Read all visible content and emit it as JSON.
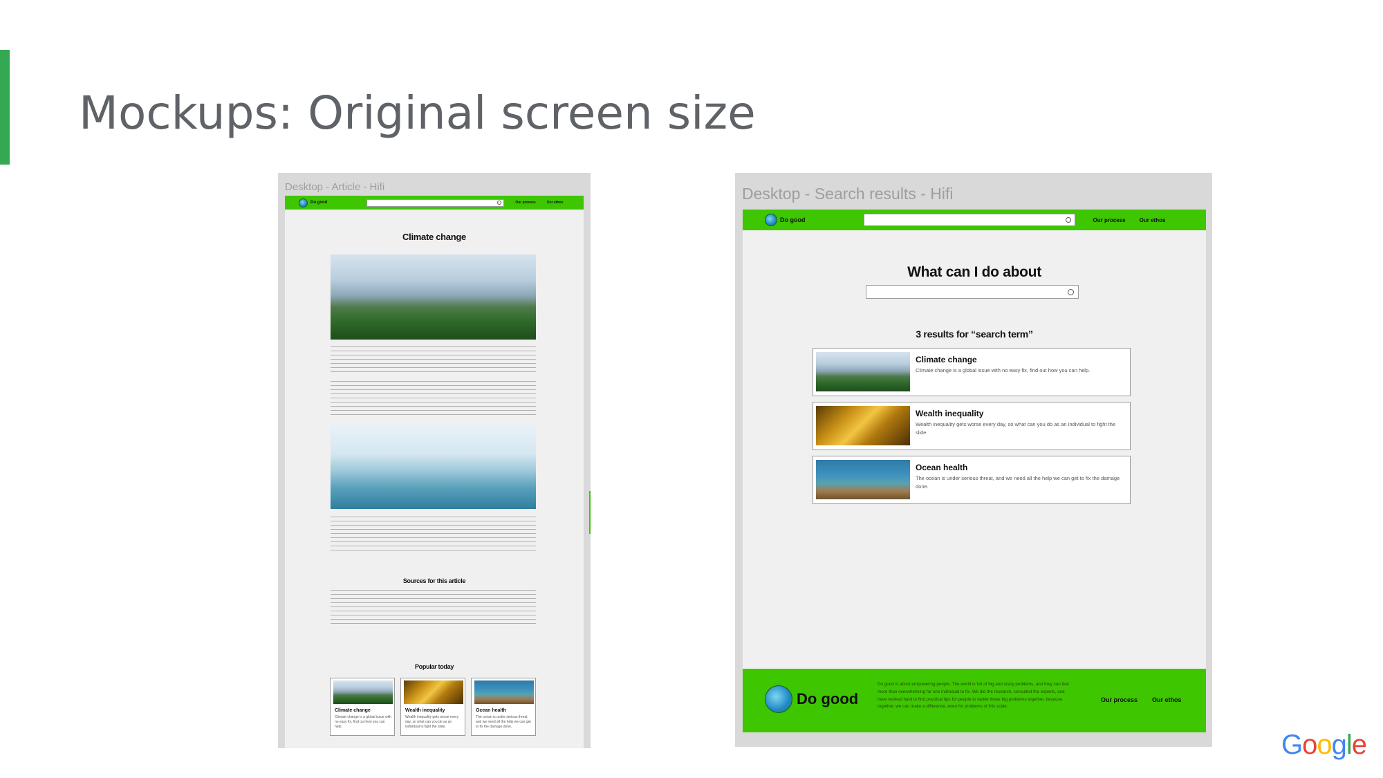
{
  "slide": {
    "title": "Mockups: Original screen size",
    "accent_color": "#34a853",
    "google_logo": [
      "G",
      "o",
      "o",
      "g",
      "l",
      "e"
    ],
    "google_colors": [
      "#4285f4",
      "#ea4335",
      "#fbbc05",
      "#4285f4",
      "#34a853",
      "#ea4335"
    ]
  },
  "brand": {
    "name": "Do good",
    "green": "#3ec600",
    "nav_links": [
      "Our process",
      "Our ethos"
    ]
  },
  "article_mockup": {
    "frame_label": "Desktop - Article - Hifi",
    "title": "Climate change",
    "sources_heading": "Sources for this article",
    "popular_heading": "Popular today",
    "popular": [
      {
        "title": "Climate change",
        "desc": "Climate change is a global issue with no easy fix, find out how you can help."
      },
      {
        "title": "Wealth inequality",
        "desc": "Wealth inequality gets worse every day, so what can you do as an individual to fight the slide."
      },
      {
        "title": "Ocean health",
        "desc": "The ocean is under serious threat, and we need all the help we can get to fix the damage done."
      }
    ]
  },
  "search_mockup": {
    "frame_label": "Desktop - Search results - Hifi",
    "heading": "What can I do about",
    "results_heading": "3 results for “search term”",
    "results": [
      {
        "title": "Climate change",
        "desc": "Climate change is a global issue with no easy fix, find out how you can help."
      },
      {
        "title": "Wealth inequality",
        "desc": "Wealth inequality gets worse every day, so what can you do as an individual to fight the slide."
      },
      {
        "title": "Ocean health",
        "desc": "The ocean is under serious threat, and we need all the help we can get to fix the damage done."
      }
    ],
    "footer_brand": "Do good",
    "footer_text": "Do good is about empowering people. The world is full of big and scary problems, and they can feel more than overwhelming for one individual to fix. We did the research, consulted the experts, and have worked hard to find practical tips for people to tackle these big problems together, because together, we can make a difference, even for problems of this scale."
  }
}
